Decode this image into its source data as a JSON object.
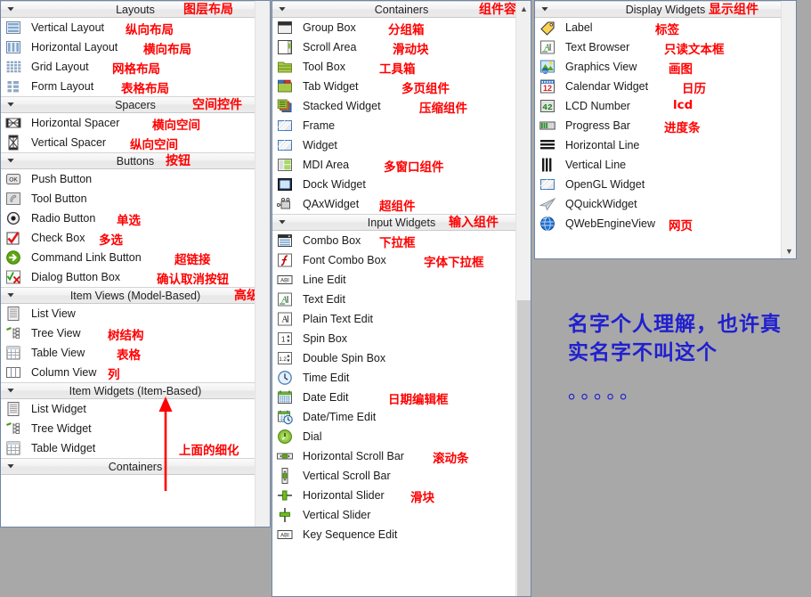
{
  "colors": {
    "annotation_red": "#ff0000",
    "note_blue": "#2020cf",
    "desktop": "#a8a8a8",
    "panel_border": "#6f86a5"
  },
  "left_panel": {
    "sections": [
      {
        "title": "Layouts",
        "cn": "图层布局",
        "items": [
          {
            "icon": "vertical-layout-icon",
            "label": "Vertical Layout",
            "cn": "纵向布局"
          },
          {
            "icon": "horizontal-layout-icon",
            "label": "Horizontal Layout",
            "cn": "横向布局"
          },
          {
            "icon": "grid-layout-icon",
            "label": "Grid Layout",
            "cn": "网格布局"
          },
          {
            "icon": "form-layout-icon",
            "label": "Form Layout",
            "cn": "表格布局"
          }
        ]
      },
      {
        "title": "Spacers",
        "cn": "空间控件",
        "items": [
          {
            "icon": "horizontal-spacer-icon",
            "label": "Horizontal Spacer",
            "cn": "横向空间"
          },
          {
            "icon": "vertical-spacer-icon",
            "label": "Vertical Spacer",
            "cn": "纵向空间"
          }
        ]
      },
      {
        "title": "Buttons",
        "cn": "按钮",
        "items": [
          {
            "icon": "push-button-icon",
            "label": "Push Button",
            "cn": ""
          },
          {
            "icon": "tool-button-icon",
            "label": "Tool Button",
            "cn": ""
          },
          {
            "icon": "radio-button-icon",
            "label": "Radio Button",
            "cn": "单选"
          },
          {
            "icon": "check-box-icon",
            "label": "Check Box",
            "cn": "多选"
          },
          {
            "icon": "command-link-button-icon",
            "label": "Command Link Button",
            "cn": "超链接"
          },
          {
            "icon": "dialog-button-box-icon",
            "label": "Dialog Button Box",
            "cn": "确认取消按钮"
          }
        ]
      },
      {
        "title": "Item Views (Model-Based)",
        "cn": "高级视图",
        "items": [
          {
            "icon": "list-view-icon",
            "label": "List View",
            "cn": ""
          },
          {
            "icon": "tree-view-icon",
            "label": "Tree View",
            "cn": "树结构"
          },
          {
            "icon": "table-view-icon",
            "label": "Table View",
            "cn": "表格"
          },
          {
            "icon": "column-view-icon",
            "label": "Column View",
            "cn": "列"
          }
        ]
      },
      {
        "title": "Item Widgets (Item-Based)",
        "cn": "",
        "items": [
          {
            "icon": "list-widget-icon",
            "label": "List Widget",
            "cn": ""
          },
          {
            "icon": "tree-widget-icon",
            "label": "Tree Widget",
            "cn": ""
          },
          {
            "icon": "table-widget-icon",
            "label": "Table Widget",
            "cn": "上面的细化"
          }
        ]
      },
      {
        "title": "Containers",
        "cn": "",
        "items": []
      }
    ]
  },
  "mid_panel": {
    "sections": [
      {
        "title": "Containers",
        "cn": "组件容器",
        "items": [
          {
            "icon": "group-box-icon",
            "label": "Group Box",
            "cn": "分组箱"
          },
          {
            "icon": "scroll-area-icon",
            "label": "Scroll Area",
            "cn": "滑动块"
          },
          {
            "icon": "tool-box-icon",
            "label": "Tool Box",
            "cn": "工具箱"
          },
          {
            "icon": "tab-widget-icon",
            "label": "Tab Widget",
            "cn": "多页组件"
          },
          {
            "icon": "stacked-widget-icon",
            "label": "Stacked Widget",
            "cn": "压缩组件"
          },
          {
            "icon": "frame-icon",
            "label": "Frame",
            "cn": ""
          },
          {
            "icon": "widget-icon",
            "label": "Widget",
            "cn": ""
          },
          {
            "icon": "mdi-area-icon",
            "label": "MDI Area",
            "cn": "多窗口组件"
          },
          {
            "icon": "dock-widget-icon",
            "label": "Dock Widget",
            "cn": ""
          },
          {
            "icon": "qaxwidget-icon",
            "label": "QAxWidget",
            "cn": "超组件"
          }
        ]
      },
      {
        "title": "Input Widgets",
        "cn": "输入组件",
        "items": [
          {
            "icon": "combo-box-icon",
            "label": "Combo Box",
            "cn": "下拉框"
          },
          {
            "icon": "font-combo-box-icon",
            "label": "Font Combo Box",
            "cn": "字体下拉框"
          },
          {
            "icon": "line-edit-icon",
            "label": "Line Edit",
            "cn": ""
          },
          {
            "icon": "text-edit-icon",
            "label": "Text Edit",
            "cn": ""
          },
          {
            "icon": "plain-text-edit-icon",
            "label": "Plain Text Edit",
            "cn": ""
          },
          {
            "icon": "spin-box-icon",
            "label": "Spin Box",
            "cn": ""
          },
          {
            "icon": "double-spin-box-icon",
            "label": "Double Spin Box",
            "cn": ""
          },
          {
            "icon": "time-edit-icon",
            "label": "Time Edit",
            "cn": ""
          },
          {
            "icon": "date-edit-icon",
            "label": "Date Edit",
            "cn": "日期编辑框"
          },
          {
            "icon": "date-time-edit-icon",
            "label": "Date/Time Edit",
            "cn": ""
          },
          {
            "icon": "dial-icon",
            "label": "Dial",
            "cn": ""
          },
          {
            "icon": "horizontal-scroll-bar-icon",
            "label": "Horizontal Scroll Bar",
            "cn": "滚动条"
          },
          {
            "icon": "vertical-scroll-bar-icon",
            "label": "Vertical Scroll Bar",
            "cn": ""
          },
          {
            "icon": "horizontal-slider-icon",
            "label": "Horizontal Slider",
            "cn": "滑块"
          },
          {
            "icon": "vertical-slider-icon",
            "label": "Vertical Slider",
            "cn": ""
          },
          {
            "icon": "key-sequence-edit-icon",
            "label": "Key Sequence Edit",
            "cn": ""
          }
        ]
      }
    ]
  },
  "right_panel": {
    "sections": [
      {
        "title": "Display Widgets",
        "cn": "显示组件",
        "items": [
          {
            "icon": "label-icon",
            "label": "Label",
            "cn": "标签"
          },
          {
            "icon": "text-browser-icon",
            "label": "Text Browser",
            "cn": "只读文本框"
          },
          {
            "icon": "graphics-view-icon",
            "label": "Graphics View",
            "cn": "画图"
          },
          {
            "icon": "calendar-widget-icon",
            "label": "Calendar Widget",
            "cn": "日历"
          },
          {
            "icon": "lcd-number-icon",
            "label": "LCD Number",
            "cn": "lcd"
          },
          {
            "icon": "progress-bar-icon",
            "label": "Progress Bar",
            "cn": "进度条"
          },
          {
            "icon": "horizontal-line-icon",
            "label": "Horizontal Line",
            "cn": ""
          },
          {
            "icon": "vertical-line-icon",
            "label": "Vertical Line",
            "cn": ""
          },
          {
            "icon": "opengl-widget-icon",
            "label": "OpenGL Widget",
            "cn": ""
          },
          {
            "icon": "qquickwidget-icon",
            "label": "QQuickWidget",
            "cn": ""
          },
          {
            "icon": "qwebengineview-icon",
            "label": "QWebEngineView",
            "cn": "网页"
          }
        ]
      }
    ]
  },
  "annotations": {
    "blue_note": "名字个人理解，也许真实名字不叫这个",
    "blue_dots": "。。。。。"
  }
}
